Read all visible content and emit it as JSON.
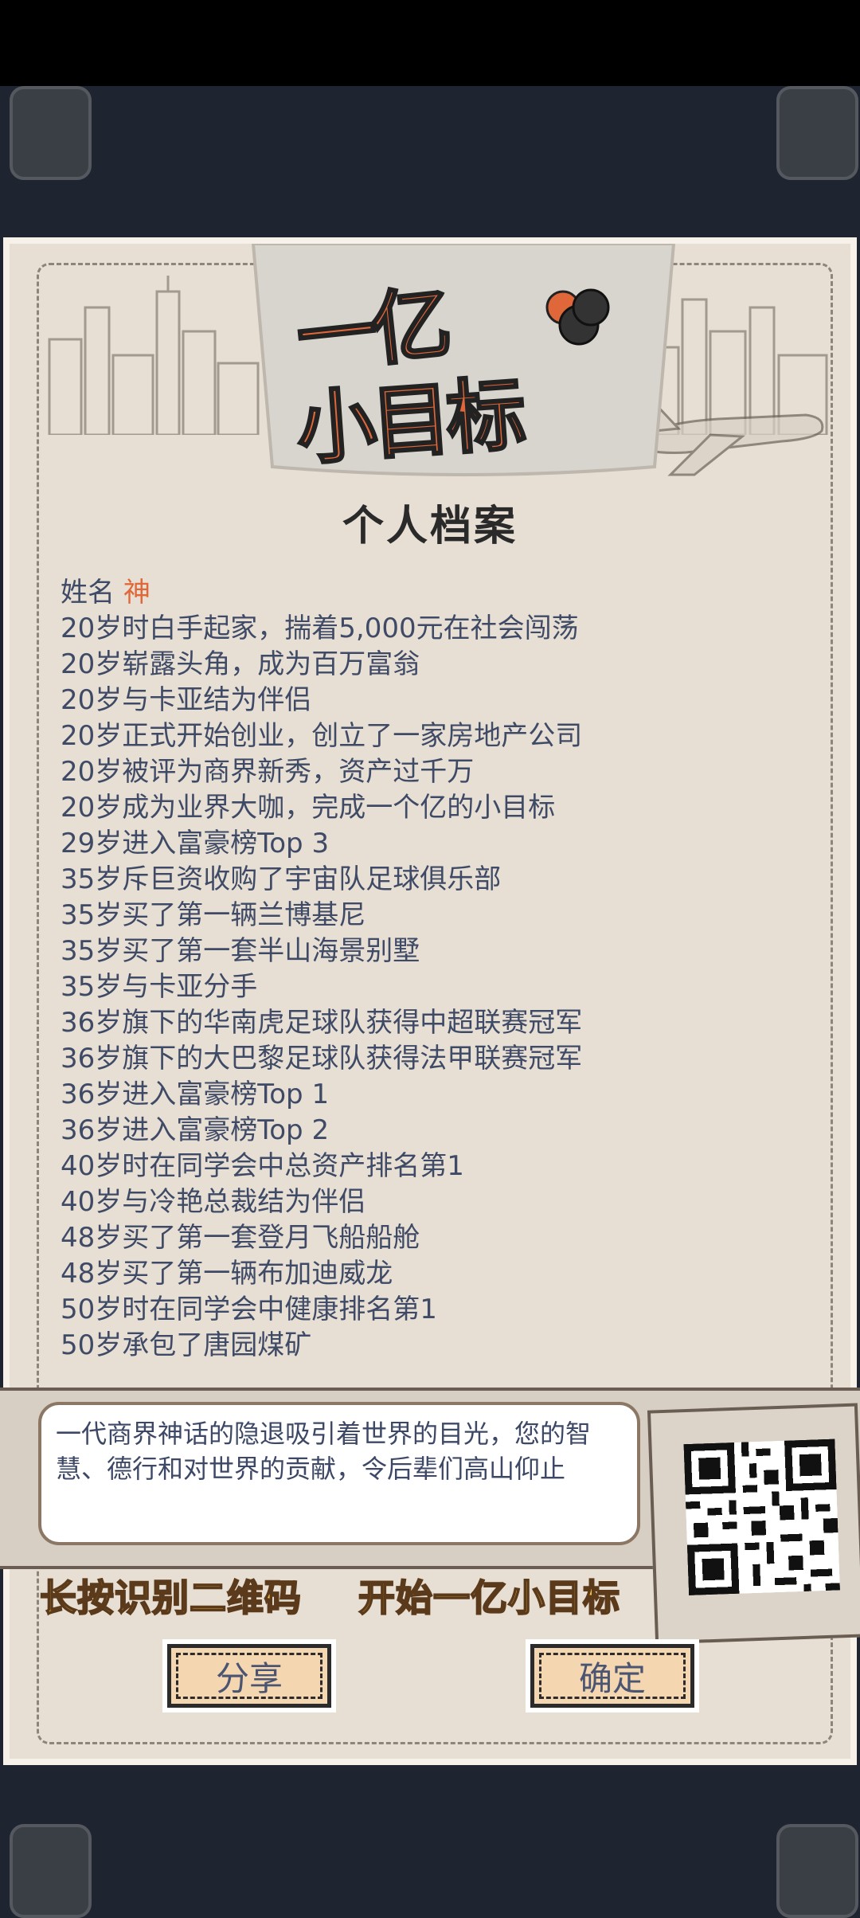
{
  "logo": {
    "line1": "一亿",
    "line2": "小目标"
  },
  "title": "个人档案",
  "profile": {
    "name_label": "姓名 ",
    "name_value": "神"
  },
  "records": [
    "20岁时白手起家，揣着5,000元在社会闯荡",
    "20岁崭露头角，成为百万富翁",
    "20岁与卡亚结为伴侣",
    "20岁正式开始创业，创立了一家房地产公司",
    "20岁被评为商界新秀，资产过千万",
    "20岁成为业界大咖，完成一个亿的小目标",
    "29岁进入富豪榜Top 3",
    "35岁斥巨资收购了宇宙队足球俱乐部",
    "35岁买了第一辆兰博基尼",
    "35岁买了第一套半山海景别墅",
    "35岁与卡亚分手",
    "36岁旗下的华南虎足球队获得中超联赛冠军",
    "36岁旗下的大巴黎足球队获得法甲联赛冠军",
    "36岁进入富豪榜Top 1",
    "36岁进入富豪榜Top 2",
    "40岁时在同学会中总资产排名第1",
    "40岁与冷艳总裁结为伴侣",
    "48岁买了第一套登月飞船船舱",
    "48岁买了第一辆布加迪威龙",
    "50岁时在同学会中健康排名第1",
    "50岁承包了唐园煤矿"
  ],
  "message": "一代商界神话的隐退吸引着世界的目光，您的智慧、德行和对世界的贡献，令后辈们高山仰止",
  "qr_hint": "长按识别二维码",
  "qr_cta": "开始一亿小目标",
  "buttons": {
    "share": "分享",
    "confirm": "确定"
  },
  "colors": {
    "accent": "#e0673a",
    "text": "#3f4a66",
    "yellow": "#f5c142",
    "paper": "#e7dfd3"
  }
}
